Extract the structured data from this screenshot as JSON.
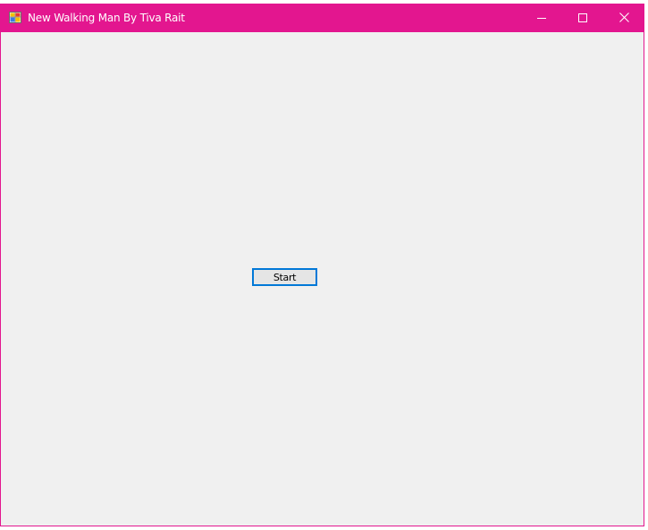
{
  "window": {
    "title": "New Walking Man By Tiva Rait",
    "title_color": "#ffffff",
    "accent_color": "#e3168f",
    "app_icon": "windows-form-icon",
    "controls": {
      "minimize_icon": "minimize-icon",
      "maximize_icon": "maximize-icon",
      "close_icon": "close-icon"
    }
  },
  "client": {
    "background": "#f0f0f0",
    "start_button": {
      "label": "Start",
      "focus_color": "#0078d7"
    }
  }
}
